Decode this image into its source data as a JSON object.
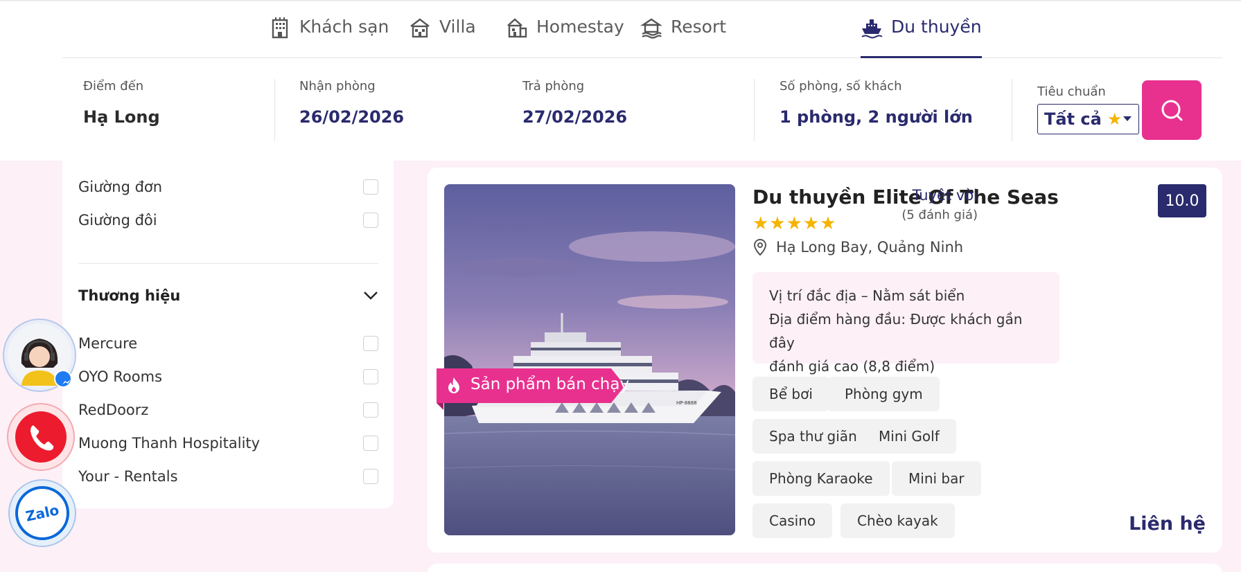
{
  "tabs": [
    {
      "label": "Khách sạn",
      "icon": "hotel-icon"
    },
    {
      "label": "Villa",
      "icon": "villa-icon"
    },
    {
      "label": "Homestay",
      "icon": "homestay-icon"
    },
    {
      "label": "Resort",
      "icon": "resort-icon"
    },
    {
      "label": "Du thuyền",
      "icon": "cruise-icon",
      "active": true
    }
  ],
  "search": {
    "destination": {
      "label": "Điểm đến",
      "value": "Hạ Long"
    },
    "checkin": {
      "label": "Nhận phòng",
      "value": "26/02/2026"
    },
    "checkout": {
      "label": "Trả phòng",
      "value": "27/02/2026"
    },
    "guests": {
      "label": "Số phòng, số khách",
      "value": "1 phòng, 2 người lớn"
    },
    "standard": {
      "label": "Tiêu chuẩn",
      "value": "Tất cả",
      "star": "★"
    }
  },
  "filters": {
    "bed_types": [
      {
        "label": "Giường đơn"
      },
      {
        "label": "Giường đôi"
      }
    ],
    "brand_heading": "Thương hiệu",
    "brands": [
      {
        "label": "Mercure"
      },
      {
        "label": "OYO Rooms"
      },
      {
        "label": "RedDoorz"
      },
      {
        "label": "Muong Thanh Hospitality"
      },
      {
        "label": "Your - Rentals"
      }
    ]
  },
  "listing": {
    "badge": "Sản phẩm bán chạy",
    "title": "Du thuyền Elite Of The Seas",
    "stars": "★★★★★",
    "location": "Hạ Long Bay, Quảng Ninh",
    "highlight_1": "Vị trí đắc địa – Nằm sát biển",
    "highlight_2": "Địa điểm hàng đầu: Được khách gần đây",
    "highlight_3": "đánh giá cao (8,8 điểm)",
    "rating_label": "Tuyệt vời",
    "review_count": "(5 đánh giá)",
    "score": "10.0",
    "amenities": [
      "Bể bơi",
      "Phòng gym",
      "Spa thư giãn",
      "Mini Golf",
      "Phòng Karaoke",
      "Mini bar",
      "Casino",
      "Chèo kayak"
    ],
    "cta": "Liên hệ",
    "hull_text": "HP-8888"
  },
  "colors": {
    "primary": "#2a2a6e",
    "accent": "#e8318f",
    "star": "#f5b400",
    "page_bg": "#fdf0f7"
  }
}
